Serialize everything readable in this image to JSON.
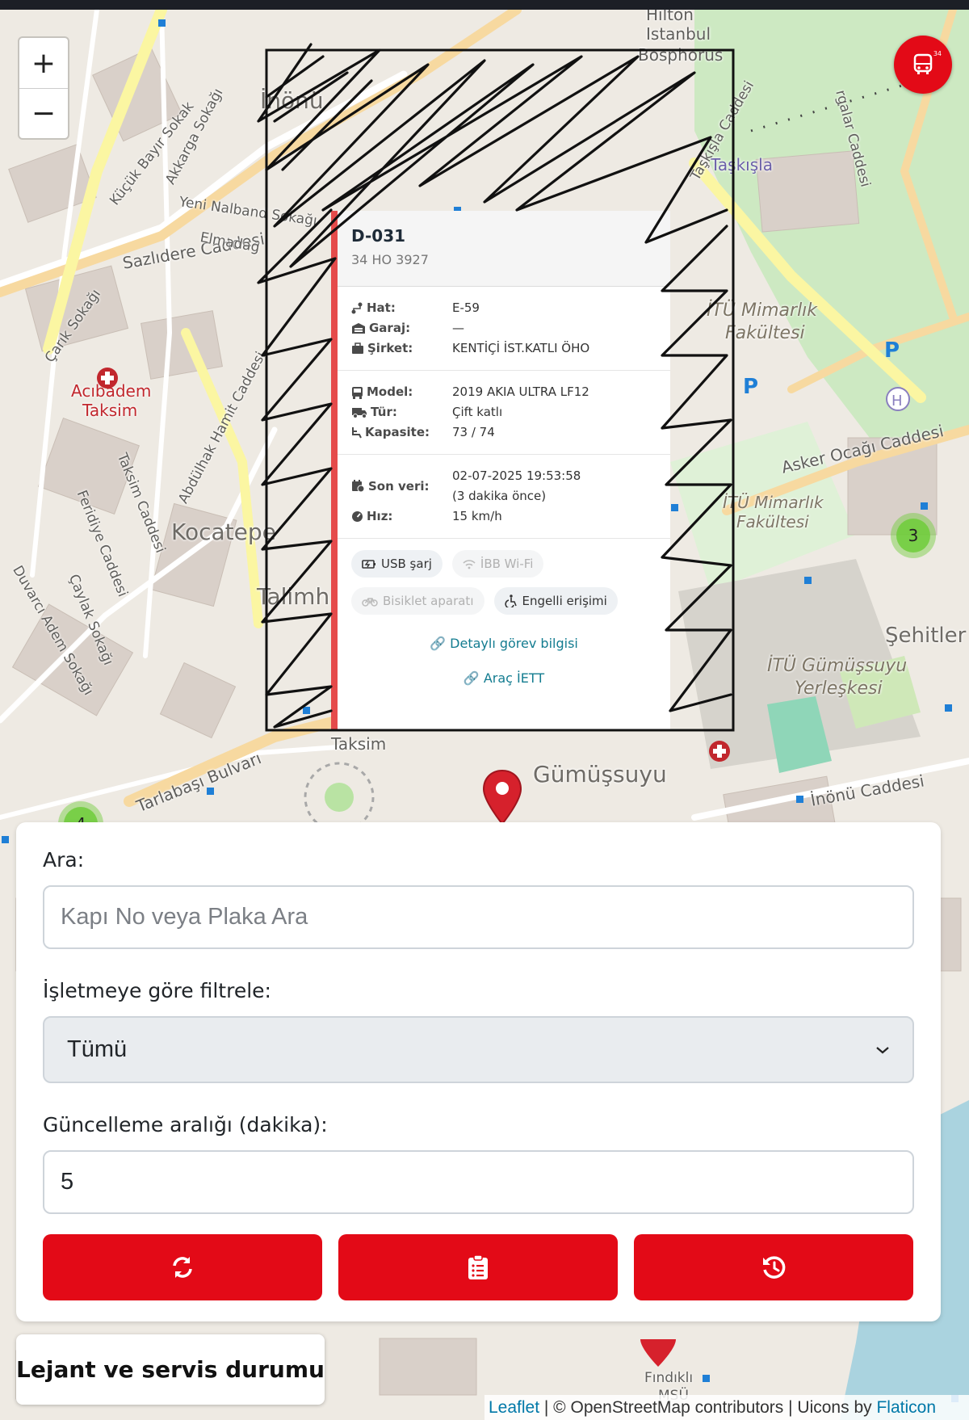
{
  "map": {
    "zoom_in": "+",
    "zoom_out": "−",
    "fab_count": "34",
    "clusters": [
      "3",
      "4"
    ],
    "labels": {
      "hilton": "Hilton",
      "istanbul": "Istanbul",
      "bosphorus": "Bosphorus",
      "inonu": "İnönü",
      "taksim_area": "Taksim",
      "kocatepe": "Kocatepe",
      "talimhane": "Talimh",
      "gumussuyu": "Gümüşsuyu",
      "taskisla": "Taşkışla",
      "itu_mimarlik": "İTÜ Mimarlık",
      "fakultesi": "Fakültesi",
      "itu_mimarlik2": "İTÜ Mimarlık",
      "fakultesi2": "Fakültesi",
      "itu_gumussuyu": "İTÜ Gümüşsuyu",
      "yerleskesi": "Yerleşkesi",
      "sehitler": "Şehitler",
      "acibadem": "Acıbadem",
      "acibadem2": "Taksim",
      "asker_ocagi": "Asker Ocağı Caddesi",
      "inonu_cad": "İnönü Caddesi",
      "sazlidere": "Sazlıdere Caddesi",
      "elmadag": "Elmadağ",
      "yeni_nalband": "Yeni Nalband Sokağı",
      "tarlabasi": "Tarlabaşı Bulvarı",
      "abdulhak": "Abdülhak Hamit Caddesi",
      "taksim_cad": "Taksim Caddesi",
      "feridiye": "Feridiye Caddesi",
      "caylak": "Çaylak Sokağı",
      "duvarci": "Duvarcı Adem Sokağı",
      "kucuk_bayir": "Küçük Bayır Sokak",
      "akkarga": "Akkarga Sokağı",
      "carik": "Çarık Sokağı",
      "fındıklı": "Fındıklı",
      "msu": "MSÜ",
      "taskisla_cad": "Taşkışla Caddesi",
      "aygaz": "rgalar Caddesi"
    }
  },
  "popup": {
    "door_no": "D-031",
    "plate": "34 HO 3927",
    "line_label": "Hat:",
    "line_value": "E-59",
    "garage_label": "Garaj:",
    "garage_value": "—",
    "company_label": "Şirket:",
    "company_value": "KENTİÇİ İST.KATLI ÖHO",
    "model_label": "Model:",
    "model_value": "2019 AKIA ULTRA LF12",
    "type_label": "Tür:",
    "type_value": "Çift katlı",
    "capacity_label": "Kapasite:",
    "capacity_value": "73 / 74",
    "last_data_label": "Son veri:",
    "last_data_value": "02-07-2025 19:53:58",
    "last_data_ago": "(3 dakika önce)",
    "speed_label": "Hız:",
    "speed_value": "15 km/h",
    "tags": [
      {
        "label": "USB şarj",
        "active": true
      },
      {
        "label": "İBB Wi-Fi",
        "active": false
      },
      {
        "label": "Bisiklet aparatı",
        "active": false
      },
      {
        "label": "Engelli erişimi",
        "active": true
      }
    ],
    "link_details": "Detaylı görev bilgisi",
    "link_iett": "Araç İETT"
  },
  "panel": {
    "search_label": "Ara:",
    "search_placeholder": "Kapı No veya Plaka Ara",
    "search_value": "",
    "filter_label": "İşletmeye göre filtrele:",
    "filter_selected": "Tümü",
    "interval_label": "Güncelleme aralığı (dakika):",
    "interval_value": "5",
    "buttons": [
      {
        "icon": "refresh-icon"
      },
      {
        "icon": "clipboard-list-icon"
      },
      {
        "icon": "history-icon"
      }
    ]
  },
  "legend": {
    "label": "Lejant ve servis durumu"
  },
  "attribution": {
    "leaflet": "Leaflet",
    "osm": " | © OpenStreetMap contributors | Uicons by ",
    "flaticon": "Flaticon"
  },
  "colors": {
    "accent": "#e30a17",
    "popup_border": "#e54b4b",
    "link": "#137c90",
    "cluster": "#6ecc39"
  }
}
